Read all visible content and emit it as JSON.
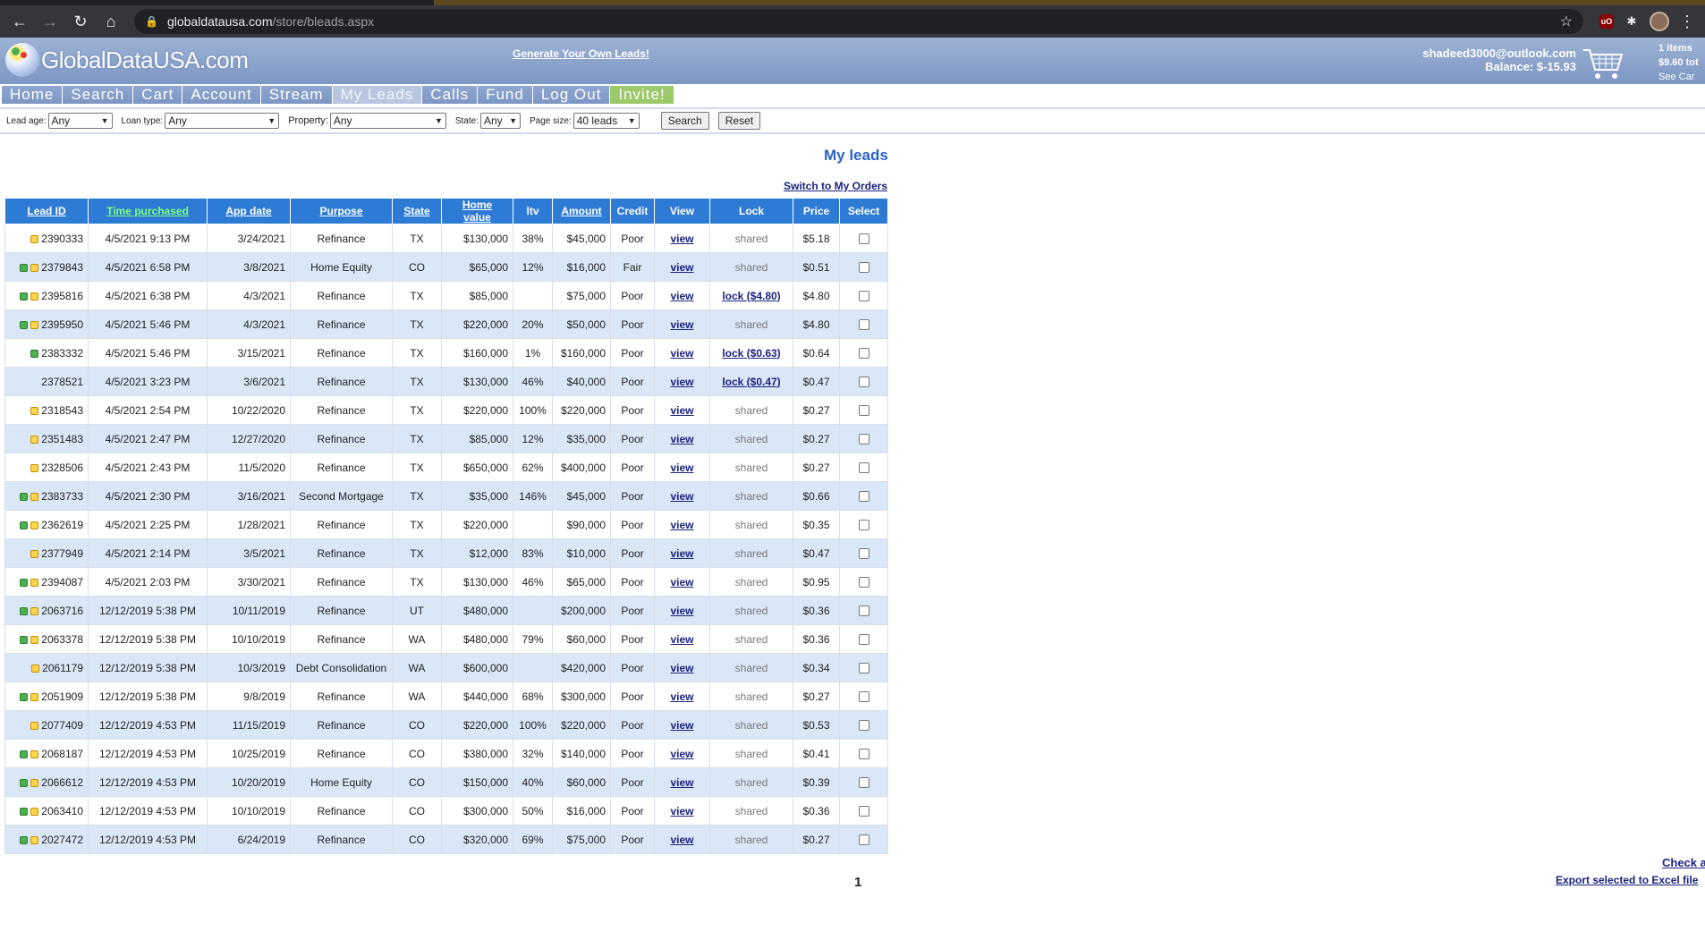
{
  "browser": {
    "url_host": "globaldatausa.com",
    "url_path": "/store/bleads.aspx"
  },
  "header": {
    "logo_text": "GlobalDataUSA.com",
    "generate_link": "Generate Your Own Leads!",
    "user_email": "shadeed3000@outlook.com",
    "balance": "Balance: $-15.93",
    "cart_items": "1 items",
    "cart_total": "$9.60 tot",
    "cart_see": "See Car"
  },
  "nav": {
    "items": [
      {
        "label": "Home"
      },
      {
        "label": "Search"
      },
      {
        "label": "Cart"
      },
      {
        "label": "Account"
      },
      {
        "label": "Stream"
      },
      {
        "label": "My Leads"
      },
      {
        "label": "Calls"
      },
      {
        "label": "Fund"
      },
      {
        "label": "Log Out"
      },
      {
        "label": "Invite!"
      }
    ]
  },
  "filters": {
    "lead_age_label": "Lead age:",
    "lead_age_value": "Any",
    "loan_type_label": "Loan type:",
    "loan_type_value": "Any",
    "property_label": "Property:",
    "property_value": "Any",
    "state_label": "State:",
    "state_value": "Any",
    "page_size_label": "Page size:",
    "page_size_value": "40 leads",
    "search_button": "Search",
    "reset_button": "Reset"
  },
  "main": {
    "title": "My leads",
    "switch_link": "Switch to My Orders",
    "pager": "1",
    "check_link": "Check a",
    "export_link": "Export selected to Excel file"
  },
  "table": {
    "headers": [
      "Lead ID",
      "Time purchased",
      "App date",
      "Purpose",
      "State",
      "Home value",
      "ltv",
      "Amount",
      "Credit",
      "View",
      "Lock",
      "Price",
      "Select"
    ],
    "rows": [
      {
        "icons": "y",
        "id": "2390333",
        "time": "4/5/2021 9:13 PM",
        "app": "3/24/2021",
        "purpose": "Refinance",
        "state": "TX",
        "home": "$130,000",
        "ltv": "38%",
        "amount": "$45,000",
        "credit": "Poor",
        "view": "view",
        "lock": "shared",
        "price": "$5.18"
      },
      {
        "icons": "gy",
        "id": "2379843",
        "time": "4/5/2021 6:58 PM",
        "app": "3/8/2021",
        "purpose": "Home Equity",
        "state": "CO",
        "home": "$65,000",
        "ltv": "12%",
        "amount": "$16,000",
        "credit": "Fair",
        "view": "view",
        "lock": "shared",
        "price": "$0.51"
      },
      {
        "icons": "gy",
        "id": "2395816",
        "time": "4/5/2021 6:38 PM",
        "app": "4/3/2021",
        "purpose": "Refinance",
        "state": "TX",
        "home": "$85,000",
        "ltv": "",
        "amount": "$75,000",
        "credit": "Poor",
        "view": "view",
        "lock": "lock ($4.80)",
        "price": "$4.80"
      },
      {
        "icons": "gy",
        "id": "2395950",
        "time": "4/5/2021 5:46 PM",
        "app": "4/3/2021",
        "purpose": "Refinance",
        "state": "TX",
        "home": "$220,000",
        "ltv": "20%",
        "amount": "$50,000",
        "credit": "Poor",
        "view": "view",
        "lock": "shared",
        "price": "$4.80"
      },
      {
        "icons": "g",
        "id": "2383332",
        "time": "4/5/2021 5:46 PM",
        "app": "3/15/2021",
        "purpose": "Refinance",
        "state": "TX",
        "home": "$160,000",
        "ltv": "1%",
        "amount": "$160,000",
        "credit": "Poor",
        "view": "view",
        "lock": "lock ($0.63)",
        "price": "$0.64"
      },
      {
        "icons": "",
        "id": "2378521",
        "time": "4/5/2021 3:23 PM",
        "app": "3/6/2021",
        "purpose": "Refinance",
        "state": "TX",
        "home": "$130,000",
        "ltv": "46%",
        "amount": "$40,000",
        "credit": "Poor",
        "view": "view",
        "lock": "lock ($0.47)",
        "price": "$0.47"
      },
      {
        "icons": "y",
        "id": "2318543",
        "time": "4/5/2021 2:54 PM",
        "app": "10/22/2020",
        "purpose": "Refinance",
        "state": "TX",
        "home": "$220,000",
        "ltv": "100%",
        "amount": "$220,000",
        "credit": "Poor",
        "view": "view",
        "lock": "shared",
        "price": "$0.27"
      },
      {
        "icons": "y",
        "id": "2351483",
        "time": "4/5/2021 2:47 PM",
        "app": "12/27/2020",
        "purpose": "Refinance",
        "state": "TX",
        "home": "$85,000",
        "ltv": "12%",
        "amount": "$35,000",
        "credit": "Poor",
        "view": "view",
        "lock": "shared",
        "price": "$0.27"
      },
      {
        "icons": "y",
        "id": "2328506",
        "time": "4/5/2021 2:43 PM",
        "app": "11/5/2020",
        "purpose": "Refinance",
        "state": "TX",
        "home": "$650,000",
        "ltv": "62%",
        "amount": "$400,000",
        "credit": "Poor",
        "view": "view",
        "lock": "shared",
        "price": "$0.27"
      },
      {
        "icons": "gy",
        "id": "2383733",
        "time": "4/5/2021 2:30 PM",
        "app": "3/16/2021",
        "purpose": "Second Mortgage",
        "state": "TX",
        "home": "$35,000",
        "ltv": "146%",
        "amount": "$45,000",
        "credit": "Poor",
        "view": "view",
        "lock": "shared",
        "price": "$0.66"
      },
      {
        "icons": "gy",
        "id": "2362619",
        "time": "4/5/2021 2:25 PM",
        "app": "1/28/2021",
        "purpose": "Refinance",
        "state": "TX",
        "home": "$220,000",
        "ltv": "",
        "amount": "$90,000",
        "credit": "Poor",
        "view": "view",
        "lock": "shared",
        "price": "$0.35"
      },
      {
        "icons": "y",
        "id": "2377949",
        "time": "4/5/2021 2:14 PM",
        "app": "3/5/2021",
        "purpose": "Refinance",
        "state": "TX",
        "home": "$12,000",
        "ltv": "83%",
        "amount": "$10,000",
        "credit": "Poor",
        "view": "view",
        "lock": "shared",
        "price": "$0.47"
      },
      {
        "icons": "gy",
        "id": "2394087",
        "time": "4/5/2021 2:03 PM",
        "app": "3/30/2021",
        "purpose": "Refinance",
        "state": "TX",
        "home": "$130,000",
        "ltv": "46%",
        "amount": "$65,000",
        "credit": "Poor",
        "view": "view",
        "lock": "shared",
        "price": "$0.95"
      },
      {
        "icons": "gy",
        "id": "2063716",
        "time": "12/12/2019 5:38 PM",
        "app": "10/11/2019",
        "purpose": "Refinance",
        "state": "UT",
        "home": "$480,000",
        "ltv": "",
        "amount": "$200,000",
        "credit": "Poor",
        "view": "view",
        "lock": "shared",
        "price": "$0.36"
      },
      {
        "icons": "gy",
        "id": "2063378",
        "time": "12/12/2019 5:38 PM",
        "app": "10/10/2019",
        "purpose": "Refinance",
        "state": "WA",
        "home": "$480,000",
        "ltv": "79%",
        "amount": "$60,000",
        "credit": "Poor",
        "view": "view",
        "lock": "shared",
        "price": "$0.36"
      },
      {
        "icons": "y",
        "id": "2061179",
        "time": "12/12/2019 5:38 PM",
        "app": "10/3/2019",
        "purpose": "Debt Consolidation",
        "state": "WA",
        "home": "$600,000",
        "ltv": "",
        "amount": "$420,000",
        "credit": "Poor",
        "view": "view",
        "lock": "shared",
        "price": "$0.34"
      },
      {
        "icons": "gy",
        "id": "2051909",
        "time": "12/12/2019 5:38 PM",
        "app": "9/8/2019",
        "purpose": "Refinance",
        "state": "WA",
        "home": "$440,000",
        "ltv": "68%",
        "amount": "$300,000",
        "credit": "Poor",
        "view": "view",
        "lock": "shared",
        "price": "$0.27"
      },
      {
        "icons": "y",
        "id": "2077409",
        "time": "12/12/2019 4:53 PM",
        "app": "11/15/2019",
        "purpose": "Refinance",
        "state": "CO",
        "home": "$220,000",
        "ltv": "100%",
        "amount": "$220,000",
        "credit": "Poor",
        "view": "view",
        "lock": "shared",
        "price": "$0.53"
      },
      {
        "icons": "gy",
        "id": "2068187",
        "time": "12/12/2019 4:53 PM",
        "app": "10/25/2019",
        "purpose": "Refinance",
        "state": "CO",
        "home": "$380,000",
        "ltv": "32%",
        "amount": "$140,000",
        "credit": "Poor",
        "view": "view",
        "lock": "shared",
        "price": "$0.41"
      },
      {
        "icons": "gy",
        "id": "2066612",
        "time": "12/12/2019 4:53 PM",
        "app": "10/20/2019",
        "purpose": "Home Equity",
        "state": "CO",
        "home": "$150,000",
        "ltv": "40%",
        "amount": "$60,000",
        "credit": "Poor",
        "view": "view",
        "lock": "shared",
        "price": "$0.39"
      },
      {
        "icons": "gy",
        "id": "2063410",
        "time": "12/12/2019 4:53 PM",
        "app": "10/10/2019",
        "purpose": "Refinance",
        "state": "CO",
        "home": "$300,000",
        "ltv": "50%",
        "amount": "$16,000",
        "credit": "Poor",
        "view": "view",
        "lock": "shared",
        "price": "$0.36"
      },
      {
        "icons": "gy",
        "id": "2027472",
        "time": "12/12/2019 4:53 PM",
        "app": "6/24/2019",
        "purpose": "Refinance",
        "state": "CO",
        "home": "$320,000",
        "ltv": "69%",
        "amount": "$75,000",
        "credit": "Poor",
        "view": "view",
        "lock": "shared",
        "price": "$0.27"
      }
    ]
  }
}
